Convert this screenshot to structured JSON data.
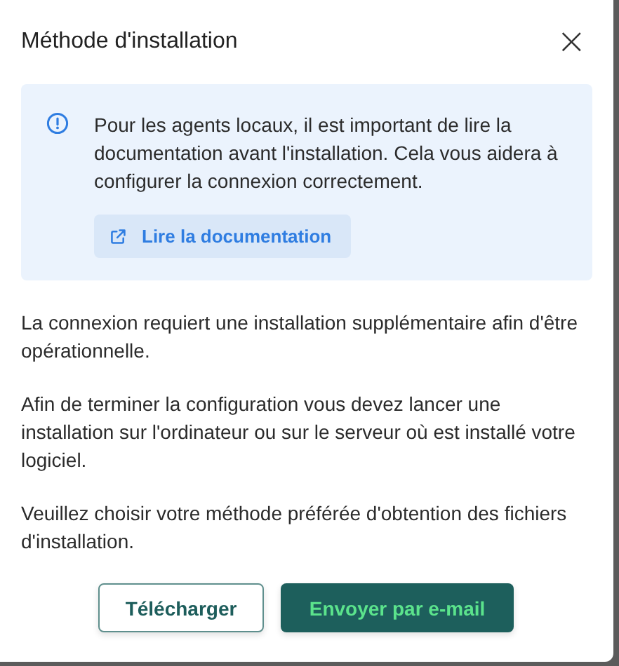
{
  "dialog": {
    "title": "Méthode d'installation",
    "close": "×"
  },
  "notice": {
    "text": "Pour les agents locaux, il est important de lire la documentation avant l'installation. Cela vous aidera à configurer la connexion correctement.",
    "link": "Lire la documentation"
  },
  "paragraphs": [
    "La connexion requiert une installation supplémentaire afin d'être opérationnelle.",
    "Afin de terminer la configuration vous devez lancer une installation sur l'ordinateur ou sur le serveur où est installé votre logiciel.",
    "Veuillez choisir votre méthode préférée d'obtention des fichiers d'installation."
  ],
  "buttons": [
    {
      "label": "Télécharger",
      "kind": "secondary"
    },
    {
      "label": "Envoyer par e-mail",
      "kind": "primary"
    }
  ]
}
